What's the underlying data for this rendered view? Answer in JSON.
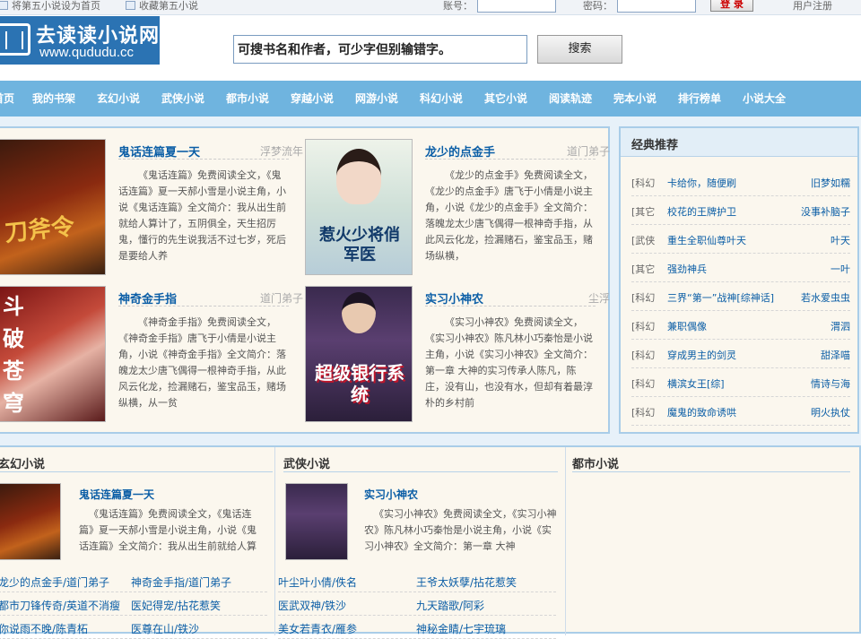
{
  "topbar": {
    "set_home": "将第五小说设为首页",
    "bookmark": "收藏第五小说",
    "account_label": "账号：",
    "password_label": "密码：",
    "login_button": "登 录",
    "register_link": "用户注册"
  },
  "header": {
    "logo_cn": "去读读小说网",
    "logo_url": "www.qududu.cc",
    "search_placeholder": "可搜书名和作者，可少字但别输错字。",
    "search_button": "搜索"
  },
  "nav": [
    "首页",
    "我的书架",
    "玄幻小说",
    "武侠小说",
    "都市小说",
    "穿越小说",
    "网游小说",
    "科幻小说",
    "其它小说",
    "阅读轨迹",
    "完本小说",
    "排行榜单",
    "小说大全"
  ],
  "featured": [
    {
      "title": "鬼话连篇夏一天",
      "author": "浮梦流年",
      "desc": "《鬼话连篇》免费阅读全文，《鬼话连篇》夏一天郝小雪是小说主角，小说《鬼话连篇》全文简介：我从出生前就给人算计了，五阴俱全，天生招厉鬼，懂行的先生说我活不过七岁，死后是要给人养",
      "cover_text": "刀斧令"
    },
    {
      "title": "龙少的点金手",
      "author": "道门弟子",
      "desc": "《龙少的点金手》免费阅读全文，《龙少的点金手》唐飞于小倩是小说主角，小说《龙少的点金手》全文简介：落魄龙太少唐飞偶得一根神奇手指，从此风云化龙，捡漏赌石，鉴宝品玉，赌场纵横，",
      "cover_text": "惹火少将俏军医"
    },
    {
      "title": "神奇金手指",
      "author": "道门弟子",
      "desc": "《神奇金手指》免费阅读全文，《神奇金手指》唐飞于小倩是小说主角，小说《神奇金手指》全文简介：落魄龙太少唐飞偶得一根神奇手指，从此风云化龙，捡漏赌石，鉴宝品玉，赌场纵横，从一贫",
      "cover_text": "斗破苍穹"
    },
    {
      "title": "实习小神农",
      "author": "尘浮",
      "desc": "《实习小神农》免费阅读全文，《实习小神农》陈凡林小巧秦怡是小说主角，小说《实习小神农》全文简介：第一章 大神的实习传承人陈凡，陈庄，没有山，也没有水，但却有着最淳朴的乡村前",
      "cover_text": "超级银行系统"
    }
  ],
  "classic": {
    "title": "经典推荐",
    "rows": [
      {
        "cat": "[科幻",
        "title": "卡给你，随便刷",
        "author": "旧梦如糯"
      },
      {
        "cat": "[其它",
        "title": "校花的王牌护卫",
        "author": "没事补脑子"
      },
      {
        "cat": "[武侠",
        "title": "重生全职仙尊叶天",
        "author": "叶天"
      },
      {
        "cat": "[其它",
        "title": "强劲神兵",
        "author": "一叶"
      },
      {
        "cat": "[科幻",
        "title": "三界“第一”战神[综神话]",
        "author": "若水爱虫虫"
      },
      {
        "cat": "[科幻",
        "title": "兼职偶像",
        "author": "渭泗"
      },
      {
        "cat": "[科幻",
        "title": "穿成男主的剑灵",
        "author": "甜泽喵"
      },
      {
        "cat": "[科幻",
        "title": "横滨女王[综]",
        "author": "情诗与海"
      },
      {
        "cat": "[科幻",
        "title": "魔鬼的致命诱哄",
        "author": "明火执仗"
      }
    ]
  },
  "categories": [
    {
      "title": "玄幻小说",
      "featured_title": "鬼话连篇夏一天",
      "featured_desc": "《鬼话连篇》免费阅读全文，《鬼话连篇》夏一天郝小雪是小说主角，小说《鬼话连篇》全文简介：我从出生前就给人算",
      "links": [
        [
          "龙少的点金手/道门弟子",
          "神奇金手指/道门弟子"
        ],
        [
          "都市刀锋传奇/英道不消瘦",
          "医妃得宠/拈花惹笑"
        ],
        [
          "你说雨不晚/陈青柘",
          "医尊在山/铁沙"
        ]
      ]
    },
    {
      "title": "武侠小说",
      "featured_title": "实习小神农",
      "featured_desc": "《实习小神农》免费阅读全文，《实习小神农》陈凡林小巧秦怡是小说主角，小说《实习小神农》全文简介：第一章 大神",
      "links": [
        [
          "叶尘叶小倩/佚名",
          "王爷太妖孽/拈花惹笑"
        ],
        [
          "医武双神/铁沙",
          "九天踏歌/阿彩"
        ],
        [
          "美女若青衣/雁参",
          "神秘金睛/七宇琉璃"
        ]
      ]
    },
    {
      "title": "都市小说"
    }
  ]
}
